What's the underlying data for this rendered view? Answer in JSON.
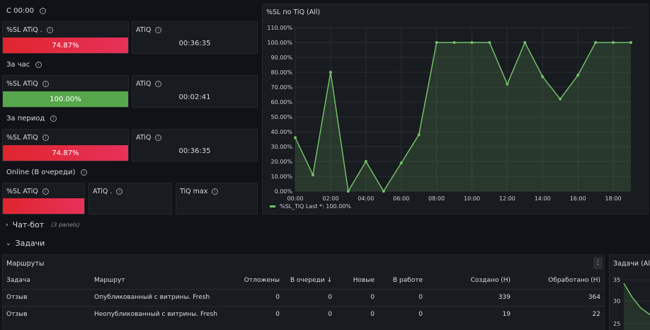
{
  "sections": {
    "since_midnight": "С 00:00",
    "last_hour": "За час",
    "period": "За период",
    "online": "Online (В очереди)"
  },
  "panels": {
    "p1_sl_title": "%SL ATiQ .",
    "p1_sl_value": "74.87%",
    "p1_atiq_title": "ATiQ",
    "p1_atiq_value": "00:36:35",
    "p2_sl_title": "%SL ATiQ",
    "p2_sl_value": "100.00%",
    "p2_atiq_title": "ATiQ",
    "p2_atiq_value": "00:02:41",
    "p3_sl_title": "%SL ATiQ",
    "p3_sl_value": "74.87%",
    "p3_atiq_title": "ATiQ",
    "p3_atiq_value": "00:36:35",
    "p4_sl_title": "%SL ATiQ",
    "p4_atiq_title": "ATiQ .",
    "p4_tiqmax_title": "TiQ max"
  },
  "colors": {
    "red": "#e0252e",
    "green": "#56a64b",
    "series": "#73bf69"
  },
  "chart_panel": {
    "title": "%SL по TiQ (All)",
    "legend": "%SL_TiQ  Last *: 100.00%"
  },
  "chart_data": {
    "type": "area",
    "series": [
      {
        "name": "%SL_TiQ",
        "x": [
          "00:00",
          "01:00",
          "02:00",
          "03:00",
          "04:00",
          "05:00",
          "06:00",
          "07:00",
          "08:00",
          "09:00",
          "10:00",
          "11:00",
          "12:00",
          "13:00",
          "14:00",
          "15:00",
          "16:00",
          "17:00",
          "18:00",
          "19:00"
        ],
        "values": [
          36,
          11,
          80,
          0,
          20,
          0,
          19,
          38,
          100,
          100,
          100,
          100,
          72,
          100,
          77,
          62,
          78,
          100,
          100,
          100
        ]
      }
    ],
    "x_ticks": [
      "00:00",
      "02:00",
      "04:00",
      "06:00",
      "08:00",
      "10:00",
      "12:00",
      "14:00",
      "16:00",
      "18:00"
    ],
    "y_ticks": [
      "0.00%",
      "10.00%",
      "20.00%",
      "30.00%",
      "40.00%",
      "50.00%",
      "60.00%",
      "70.00%",
      "80.00%",
      "90.00%",
      "100.00%",
      "110.00%"
    ],
    "ylim": [
      0,
      110
    ],
    "grid": true,
    "legend": "bottom-left"
  },
  "rows": {
    "chatbot_title": "Чат-бот",
    "chatbot_sub": "(3 panels)",
    "tasks_title": "Задачи"
  },
  "routes": {
    "title": "Маршруты",
    "columns": [
      "Задача",
      "Маршрут",
      "Отложены",
      "В очереди ↓",
      "Новые",
      "В работе",
      "Создано (Н)",
      "Обработано (Н)"
    ],
    "rows": [
      [
        "Отзыв",
        "Опубликованный с витрины. Fresh",
        "0",
        "0",
        "0",
        "0",
        "339",
        "364"
      ],
      [
        "Отзыв",
        "Неопубликованный с витрины. Fresh",
        "0",
        "0",
        "0",
        "0",
        "19",
        "22"
      ]
    ]
  },
  "side_panel": {
    "title": "Задачи (All)",
    "y_ticks": [
      "35",
      "30",
      "25"
    ]
  }
}
